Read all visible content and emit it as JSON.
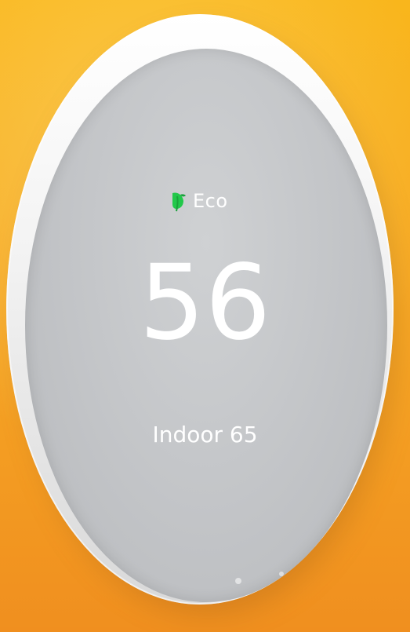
{
  "thermostat": {
    "mode_label": "Eco",
    "mode_icon": "leaf-icon",
    "target_temp": "56",
    "indoor_text": "Indoor 65"
  },
  "colors": {
    "background_top": "#f9b61c",
    "background_bottom": "#f08f1f",
    "screen": "#c2c4c7",
    "eco_green": "#22c84a",
    "text": "#ffffff"
  }
}
